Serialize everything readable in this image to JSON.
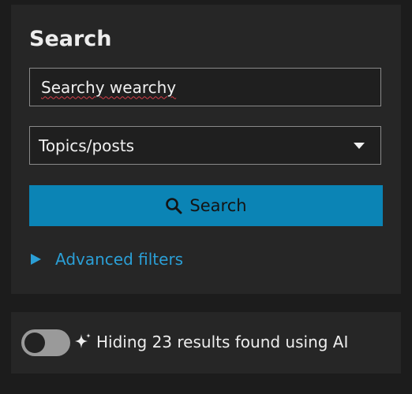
{
  "search": {
    "title": "Search",
    "query_value": "Searchy wearchy",
    "type_select_value": "Topics/posts",
    "button_label": "Search",
    "advanced_filters_label": "Advanced filters"
  },
  "ai_filter": {
    "toggle_on": false,
    "message": "Hiding 23 results found using AI"
  },
  "colors": {
    "background": "#1c1c1c",
    "panel": "#262626",
    "primary": "#0b84b5",
    "link": "#2b9fd6"
  },
  "icons": [
    "search-icon",
    "chevron-down-icon",
    "disclosure-triangle-icon",
    "sparkle-icon"
  ]
}
